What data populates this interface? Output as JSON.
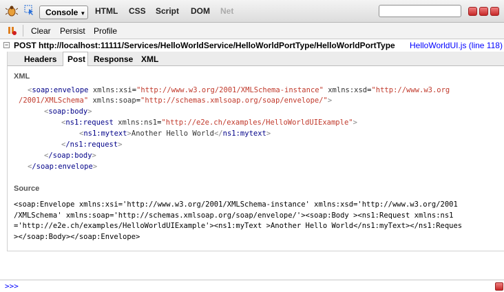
{
  "topbar": {
    "tabs": [
      "Console",
      "HTML",
      "CSS",
      "Script",
      "DOM",
      "Net"
    ],
    "search_value": ""
  },
  "toolbar": {
    "clear": "Clear",
    "persist": "Persist",
    "profile": "Profile"
  },
  "request": {
    "title": "POST http://localhost:11111/Services/HelloWorldService/HelloWorldPortType/HelloWorldPortType",
    "source_link": "HelloWorldUI.js (line 118)",
    "tabs": [
      "Headers",
      "Post",
      "Response",
      "XML"
    ]
  },
  "xml_section": {
    "title": "XML",
    "envelope_tag": "soap:envelope",
    "attr_xsi": "xmlns:xsi",
    "val_xsi": "\"http://www.w3.org/2001/XMLSchema-instance\"",
    "attr_xsd": "xmlns:xsd",
    "val_xsd_part1": "\"http://www.w3.org",
    "val_xsd_part2": "/2001/XMLSchema\"",
    "attr_soap": "xmlns:soap",
    "val_soap": "\"http://schemas.xmlsoap.org/soap/envelope/\"",
    "body_tag": "soap:body",
    "request_tag": "ns1:request",
    "attr_ns1": "xmlns:ns1",
    "val_ns1": "\"http://e2e.ch/examples/HelloWorldUIExample\"",
    "mytext_tag": "ns1:mytext",
    "mytext_value": "Another Hello World",
    "close_mytext": "ns1:mytext",
    "close_request": "/ns1:request",
    "close_body": "/soap:body",
    "close_envelope": "/soap:envelope"
  },
  "source_section": {
    "title": "Source",
    "lines": [
      "<soap:Envelope xmlns:xsi='http://www.w3.org/2001/XMLSchema-instance' xmlns:xsd='http://www.w3.org/2001",
      "/XMLSchema' xmlns:soap='http://schemas.xmlsoap.org/soap/envelope/'><soap:Body ><ns1:Request xmlns:ns1",
      "='http://e2e.ch/examples/HelloWorldUIExample'><ns1:myText >Another Hello World</ns1:myText></ns1:Reques",
      "></soap:Body></soap:Envelope>"
    ]
  },
  "commandline": {
    "prompt": ">>>"
  }
}
